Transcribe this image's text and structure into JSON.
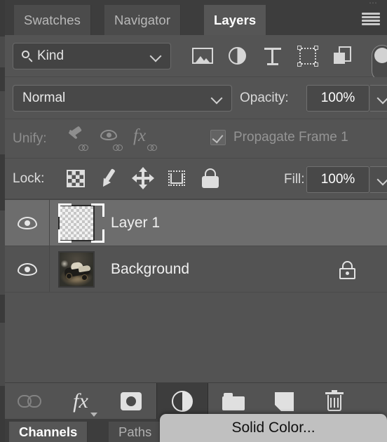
{
  "window": {
    "title": "Layers",
    "panel_menu_icon": "hamburger-menu-icon"
  },
  "top_tabs": [
    {
      "label": "Swatches",
      "active": false
    },
    {
      "label": "Navigator",
      "active": false
    },
    {
      "label": "Layers",
      "active": true
    }
  ],
  "filter_row": {
    "kind_label": "Kind",
    "search_icon": "search-icon",
    "chevron_icon": "chevron-down-icon",
    "type_filters": [
      {
        "name": "pixel-layer-filter-icon"
      },
      {
        "name": "adjustment-layer-filter-icon"
      },
      {
        "name": "type-layer-filter-icon"
      },
      {
        "name": "shape-layer-filter-icon"
      },
      {
        "name": "smart-object-filter-icon"
      }
    ],
    "toggle_state": "off"
  },
  "blend_row": {
    "blend_mode": "Normal",
    "opacity_label": "Opacity:",
    "opacity_value": "100%"
  },
  "unify_row": {
    "label": "Unify:",
    "icons": [
      {
        "name": "unify-position-icon"
      },
      {
        "name": "unify-visibility-icon"
      },
      {
        "name": "unify-style-icon"
      }
    ],
    "propagate_label": "Propagate Frame 1",
    "propagate_checked": true,
    "disabled": true
  },
  "lock_row": {
    "label": "Lock:",
    "icons": [
      {
        "name": "lock-transparent-pixels-icon"
      },
      {
        "name": "lock-image-pixels-icon"
      },
      {
        "name": "lock-position-icon"
      },
      {
        "name": "lock-artboard-nesting-icon"
      },
      {
        "name": "lock-all-icon"
      }
    ],
    "fill_label": "Fill:",
    "fill_value": "100%"
  },
  "layers": [
    {
      "name": "Layer 1",
      "visible": true,
      "selected": true,
      "thumbnail": "transparent",
      "locked": false
    },
    {
      "name": "Background",
      "visible": true,
      "selected": false,
      "thumbnail": "photo-car",
      "locked": true
    }
  ],
  "bottom_toolbar": [
    {
      "name": "link-layers-button",
      "icon": "link-icon",
      "disabled": true
    },
    {
      "name": "layer-style-button",
      "icon": "fx-icon",
      "label": "fx",
      "has_caret": true
    },
    {
      "name": "add-layer-mask-button",
      "icon": "layer-mask-icon"
    },
    {
      "name": "new-adjustment-layer-button",
      "icon": "adjustment-circle-icon",
      "pressed": true
    },
    {
      "name": "new-group-button",
      "icon": "folder-icon"
    },
    {
      "name": "new-layer-button",
      "icon": "new-layer-icon"
    },
    {
      "name": "delete-layer-button",
      "icon": "trash-icon"
    }
  ],
  "popup_menu": {
    "items": [
      {
        "label": "Solid Color..."
      }
    ]
  },
  "bottom_tabs": [
    {
      "label": "Channels",
      "active": true
    },
    {
      "label": "Paths",
      "active": false
    }
  ],
  "colors": {
    "panel_bg": "#535353",
    "tab_bg": "#4b4b4b",
    "tab_active_bg": "#565656",
    "row_selected_bg": "#6d6d6d",
    "field_bg": "#484848",
    "text": "#e4e4e4",
    "text_dim": "#8e8e8e",
    "popup_bg": "#c0c0c0",
    "popup_text": "#101010"
  }
}
